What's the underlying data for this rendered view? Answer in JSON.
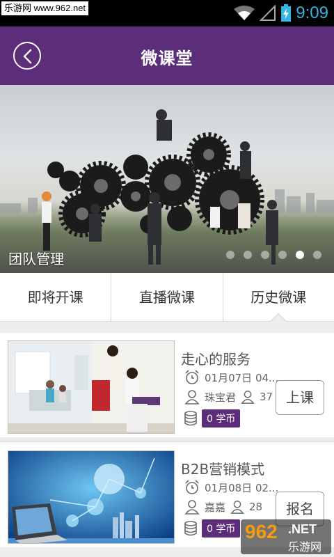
{
  "status_bar": {
    "watermark": "乐游网 www.962.net",
    "time": "9:09",
    "time_color": "#33b5e5"
  },
  "header": {
    "title": "微课堂",
    "back_icon": "back-arrow-icon",
    "bg_color": "#5c2d78"
  },
  "banner": {
    "caption": "团队管理",
    "slide_count": 6,
    "active_slide": 5
  },
  "tabs": [
    {
      "label": "即将开课",
      "selected": false
    },
    {
      "label": "直播微课",
      "selected": false
    },
    {
      "label": "历史微课",
      "selected": true
    }
  ],
  "courses": [
    {
      "title": "走心的服务",
      "date": "01月07日 04...",
      "teacher": "珠宝君",
      "count": "37",
      "price": "0 学币",
      "action": "上课"
    },
    {
      "title": "B2B营销模式",
      "date": "01月08日 02...",
      "teacher": "嘉嘉",
      "count": "28",
      "price": "0 学币",
      "action": "报名"
    }
  ],
  "watermark_logo": {
    "big": "962",
    "net": ".NET",
    "cn": "乐游网"
  }
}
